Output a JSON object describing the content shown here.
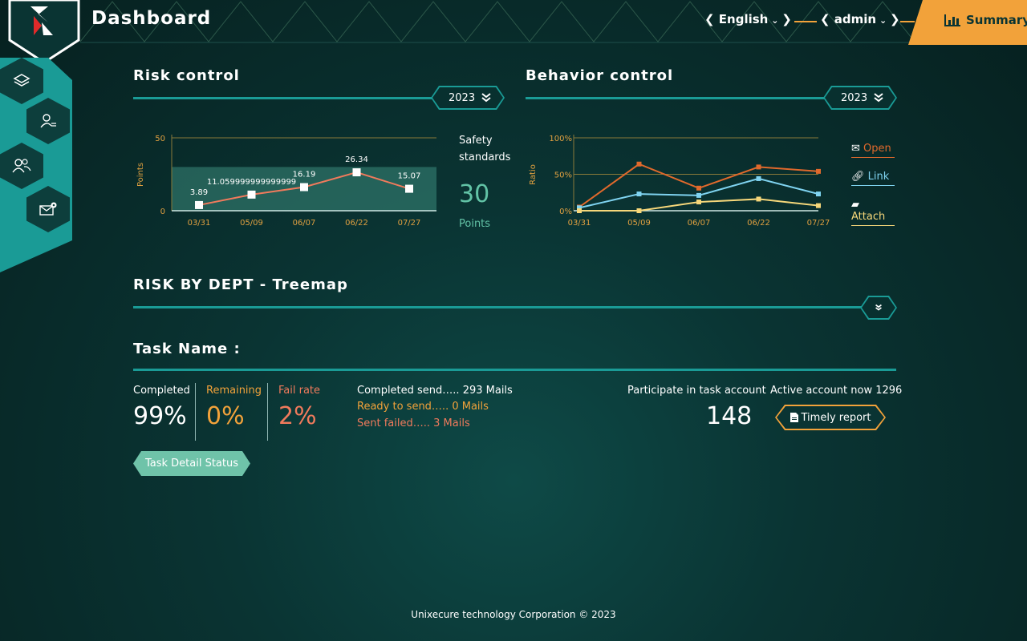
{
  "header": {
    "title": "Dashboard",
    "language": "English",
    "user": "admin",
    "summary_label": "Summary"
  },
  "sidebar": {
    "items": [
      {
        "icon": "layers-icon"
      },
      {
        "icon": "user-list-icon"
      },
      {
        "icon": "users-icon"
      },
      {
        "icon": "mail-settings-icon"
      }
    ]
  },
  "risk_control": {
    "title": "Risk control",
    "year": "2023",
    "safety_label_1": "Safety",
    "safety_label_2": "standards",
    "safety_value": "30",
    "safety_unit": "Points"
  },
  "behavior_control": {
    "title": "Behavior control",
    "year": "2023",
    "legend": [
      {
        "label": "Open",
        "color": "#e0692c",
        "icon": "envelope-open-icon"
      },
      {
        "label": "Link",
        "color": "#7fd3f0",
        "icon": "link-icon"
      },
      {
        "label": "Attach",
        "color": "#f6d77a",
        "icon": "folder-icon"
      }
    ]
  },
  "treemap": {
    "title": "RISK BY DEPT - Treemap"
  },
  "task": {
    "title": "Task Name :",
    "completed_label": "Completed",
    "completed_value": "99%",
    "remaining_label": "Remaining",
    "remaining_value": "0%",
    "fail_label": "Fail rate",
    "fail_value": "2%",
    "completed_send": "Completed send….. 293 Mails",
    "ready_send": "Ready to send….. 0 Mails",
    "sent_failed": "Sent failed….. 3 Mails",
    "participate_label": "Participate in task account",
    "participate_value": "148",
    "active_label": "Active account now 1296",
    "timely_report": "Timely report",
    "detail_button": "Task Detail Status"
  },
  "footer": "Unixecure technology Corporation © 2023",
  "colors": {
    "accent_teal": "#1a9b96",
    "accent_orange": "#f2a23a",
    "remaining": "#f2a23a",
    "fail": "#f07a5c",
    "safety_green": "#62c3a6"
  },
  "chart_data": [
    {
      "type": "line",
      "title": "",
      "ylabel": "Points",
      "xlabel": "",
      "ylim": [
        0,
        50
      ],
      "yticks": [
        "0",
        "50"
      ],
      "categories": [
        "03/31",
        "05/09",
        "06/07",
        "06/22",
        "07/27"
      ],
      "values": [
        3.89,
        11.059999999999999,
        16.19,
        26.34,
        15.07
      ],
      "data_labels": [
        "3.89",
        "11.059999999999999",
        "16.19",
        "26.34",
        "15.07"
      ],
      "band": [
        0,
        30
      ],
      "line_color": "#f07a5c"
    },
    {
      "type": "line",
      "title": "",
      "ylabel": "Ratio",
      "xlabel": "",
      "ylim": [
        0,
        100
      ],
      "yticks": [
        "0%",
        "50%",
        "100%"
      ],
      "categories": [
        "03/31",
        "05/09",
        "06/07",
        "06/22",
        "07/27"
      ],
      "series": [
        {
          "name": "Open",
          "color": "#e0692c",
          "values": [
            5,
            64,
            31,
            60,
            54
          ]
        },
        {
          "name": "Link",
          "color": "#7fd3f0",
          "values": [
            4,
            23,
            21,
            44,
            23
          ]
        },
        {
          "name": "Attach",
          "color": "#f6d77a",
          "values": [
            0,
            0,
            12,
            16,
            7
          ]
        }
      ]
    }
  ]
}
